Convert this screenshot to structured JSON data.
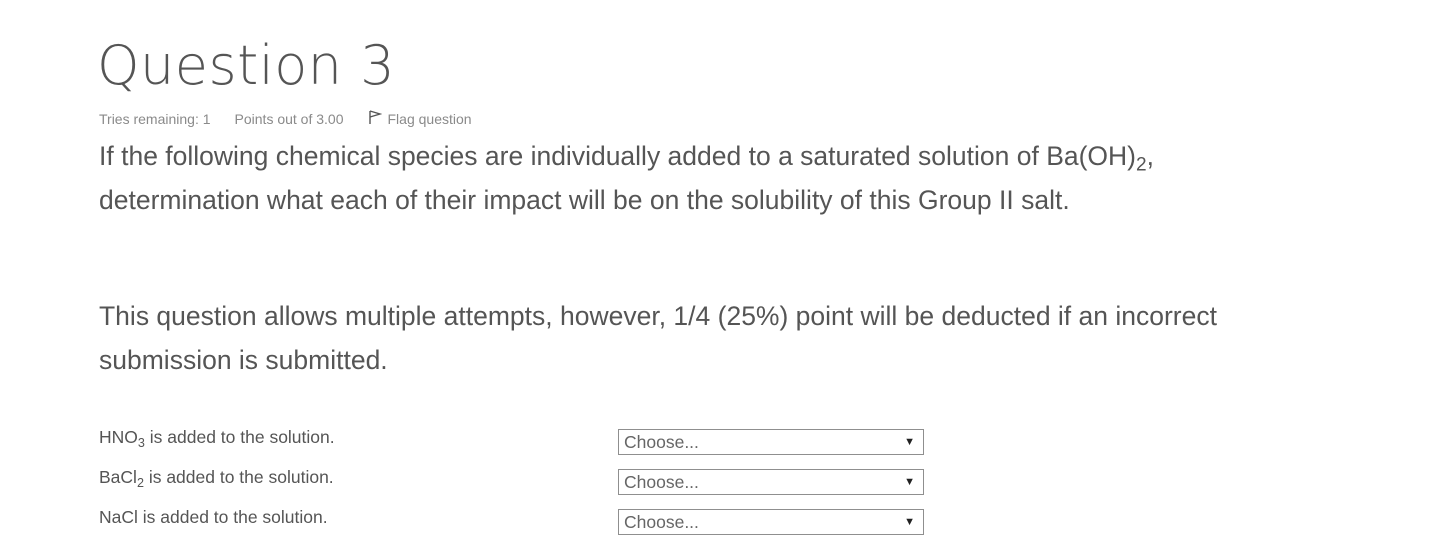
{
  "question": {
    "title": "Question 3",
    "tries_remaining": "Tries remaining: 1",
    "points": "Points out of 3.00",
    "flag_label": "Flag question",
    "text1_main": "If the following chemical species are individually added to a saturated solution of Ba(OH)",
    "text1_sub": "2",
    "text1_tail": ",",
    "text1_line2": "determination what each of their impact will be on the solubility of this Group II salt.",
    "text2": "This question allows multiple attempts, however, 1/4 (25%) point will be deducted if an incorrect submission is submitted."
  },
  "rows": [
    {
      "prefix": "HNO",
      "sub": "3",
      "suffix": " is added to the solution.",
      "select_value": "Choose..."
    },
    {
      "prefix": "BaCl",
      "sub": "2",
      "suffix": " is added to the solution.",
      "select_value": "Choose..."
    },
    {
      "prefix": "NaCl is added to the solution.",
      "sub": "",
      "suffix": "",
      "select_value": "Choose..."
    }
  ],
  "icons": {
    "flag": "flag-icon",
    "dropdown": "dropdown-arrow-icon"
  }
}
